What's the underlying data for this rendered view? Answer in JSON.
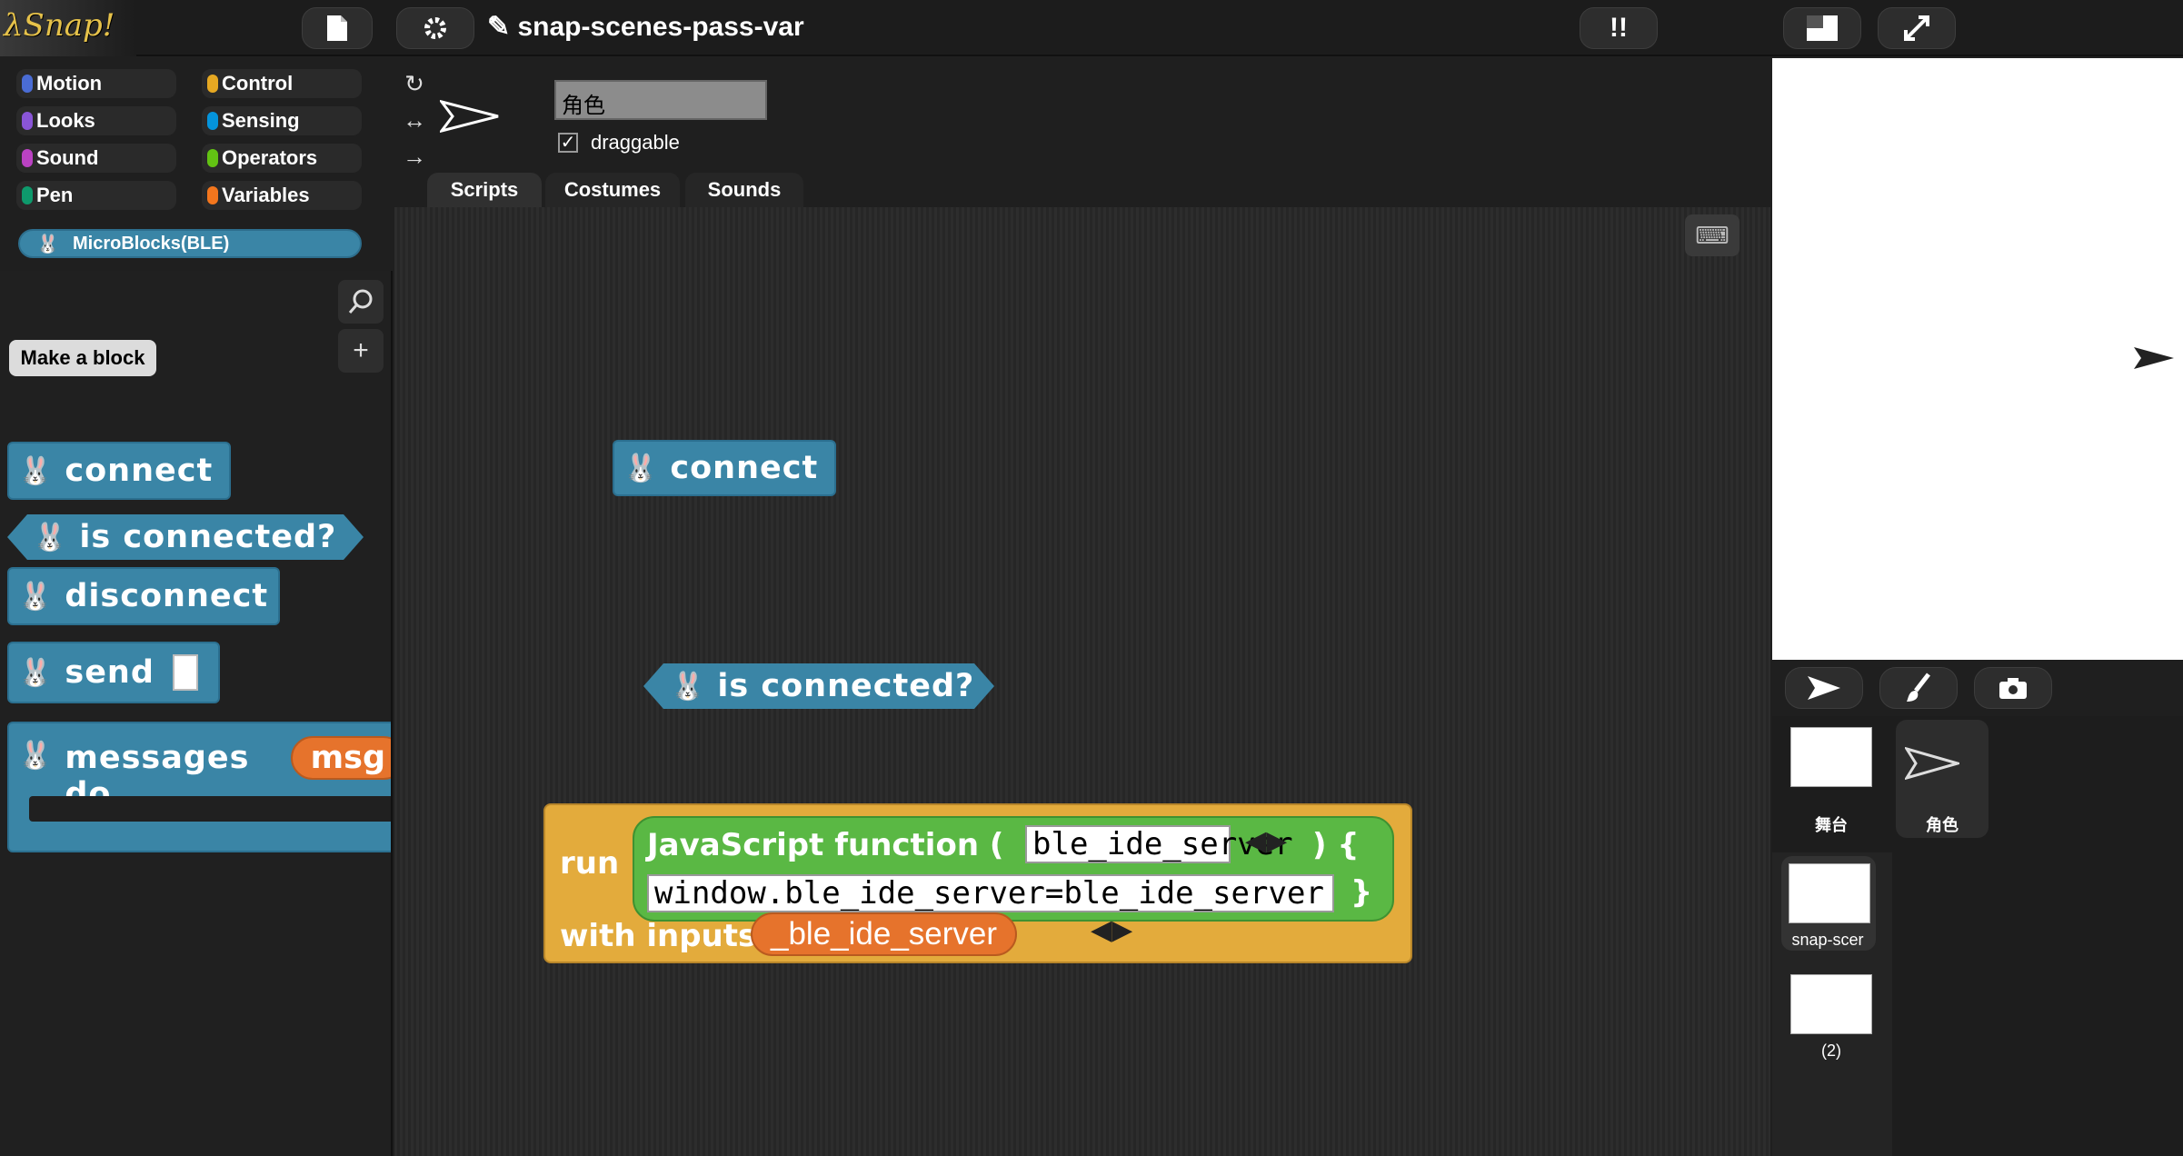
{
  "app": {
    "logo_text": "λSnap!",
    "project_title": "✎ snap-scenes-pass-var"
  },
  "categories": [
    {
      "label": "Motion",
      "color": "#4a6cd4"
    },
    {
      "label": "Looks",
      "color": "#8a55d7"
    },
    {
      "label": "Sound",
      "color": "#bb42c3"
    },
    {
      "label": "Pen",
      "color": "#0e9a6c"
    },
    {
      "label": "Control",
      "color": "#e6a822"
    },
    {
      "label": "Sensing",
      "color": "#0494dc"
    },
    {
      "label": "Operators",
      "color": "#62c213"
    },
    {
      "label": "Variables",
      "color": "#f3761d"
    }
  ],
  "library_category": "MicroBlocks(BLE)",
  "palette": {
    "make_block": "Make a block",
    "blocks": {
      "connect": "connect",
      "is_connected": "is connected?",
      "disconnect": "disconnect",
      "send": "send",
      "messages_do": "messages do",
      "msg_var": "msg"
    }
  },
  "sprite": {
    "name": "角色",
    "draggable_label": "draggable",
    "draggable_checked": true
  },
  "tabs": {
    "scripts": "Scripts",
    "costumes": "Costumes",
    "sounds": "Sounds"
  },
  "script_blocks": {
    "connect": "connect",
    "is_connected": "is connected?",
    "run": "run",
    "js_function": "JavaScript function (",
    "js_param": "ble_ide_server",
    "js_close_paren": ") {",
    "js_body": "window.ble_ide_server=ble_ide_server",
    "js_close_brace": "}",
    "with_inputs": "with inputs",
    "input_var": "_ble_ide_server"
  },
  "corral": {
    "stage_label": "舞台",
    "sprite_label": "角色",
    "scenes": [
      "snap-scer",
      "(2)"
    ]
  },
  "icons": {
    "file": "file-icon",
    "settings": "gear-icon",
    "unused": "footprints-icon",
    "stage_size": "stage-size-icon",
    "fullscreen": "fullscreen-icon",
    "zoom": "search-icon",
    "add": "plus-icon",
    "keyboard": "keyboard-icon",
    "turtle": "turtle-icon",
    "paint": "paintbrush-icon",
    "camera": "camera-icon"
  }
}
